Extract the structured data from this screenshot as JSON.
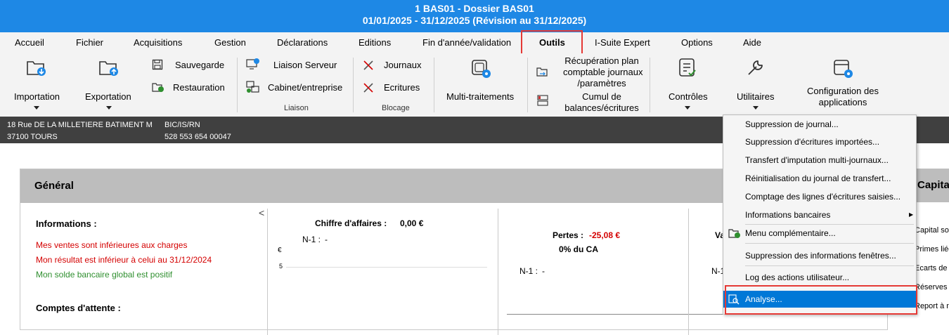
{
  "titlebar": {
    "line1": "1 BAS01 - Dossier BAS01",
    "line2": "01/01/2025 - 31/12/2025 (Révision au 31/12/2025)"
  },
  "menu": {
    "items": [
      "Accueil",
      "Fichier",
      "Acquisitions",
      "Gestion",
      "Déclarations",
      "Editions",
      "Fin d'année/validation",
      "Outils",
      "I-Suite Expert",
      "Options",
      "Aide"
    ],
    "active": "Outils"
  },
  "ribbon": {
    "importation": "Importation",
    "exportation": "Exportation",
    "sauvegarde": "Sauvegarde",
    "restauration": "Restauration",
    "liaison_serveur": "Liaison Serveur",
    "cabinet_entreprise": "Cabinet/entreprise",
    "liaison_group": "Liaison",
    "journaux": "Journaux",
    "ecritures": "Ecritures",
    "blocage_group": "Blocage",
    "multi_traitements": "Multi-traitements",
    "recuperation_line1": "Récupération plan",
    "recuperation_line2": "comptable journaux",
    "recuperation_line3": "/paramètres",
    "cumul_line1": "Cumul de",
    "cumul_line2": "balances/écritures",
    "controles": "Contrôles",
    "utilitaires": "Utilitaires",
    "config_line1": "Configuration des",
    "config_line2": "applications"
  },
  "infobar": {
    "address1": "18 Rue DE LA MILLETIERE BATIMENT M",
    "address2": "37100 TOURS",
    "regime": "BIC/IS/RN",
    "siret": "528 553 654 00047"
  },
  "general": {
    "title": "Général",
    "informations_label": "Informations :",
    "msg1": "Mes ventes sont inférieures aux charges",
    "msg2": "Mon résultat est inférieur à celui au 31/12/2024",
    "msg3": "Mon solde bancaire global est positif",
    "comptes_attente": "Comptes d'attente :",
    "collapse_glyph": "<",
    "ca_label": "Chiffre d'affaires :",
    "ca_value": "0,00 €",
    "ca_n1_label": "N-1 :",
    "ca_n1_value": "-",
    "euro_axis": "€",
    "axis_tick": "5",
    "pertes_label": "Pertes :",
    "pertes_value": "-25,08 €",
    "pertes_pct": "0% du CA",
    "pertes_n1_label": "N-1 :",
    "pertes_n1_value": "-",
    "va_label": "Va",
    "va_n1": "N-1"
  },
  "capital_panel": {
    "title": "Capita",
    "items": [
      "Capital so",
      "Primes liée",
      "Ecarts de r",
      "Réserves",
      "Report à n"
    ]
  },
  "dropdown": {
    "items": [
      "Suppression de journal...",
      "Suppression d'écritures importées...",
      "Transfert d'imputation multi-journaux...",
      "Réinitialisation du journal de transfert...",
      "Comptage des lignes d'écritures saisies...",
      "Informations bancaires",
      "Menu complémentaire...",
      "Suppression des informations fenêtres...",
      "Log des actions utilisateur...",
      "Analyse..."
    ],
    "highlighted": "Analyse...",
    "submenu_arrow": "▶"
  },
  "colors": {
    "titlebar": "#1e88e5",
    "highlight": "#0078d7",
    "annotation": "#e53935",
    "negative": "#d40000",
    "positive": "#2f8f2f"
  }
}
